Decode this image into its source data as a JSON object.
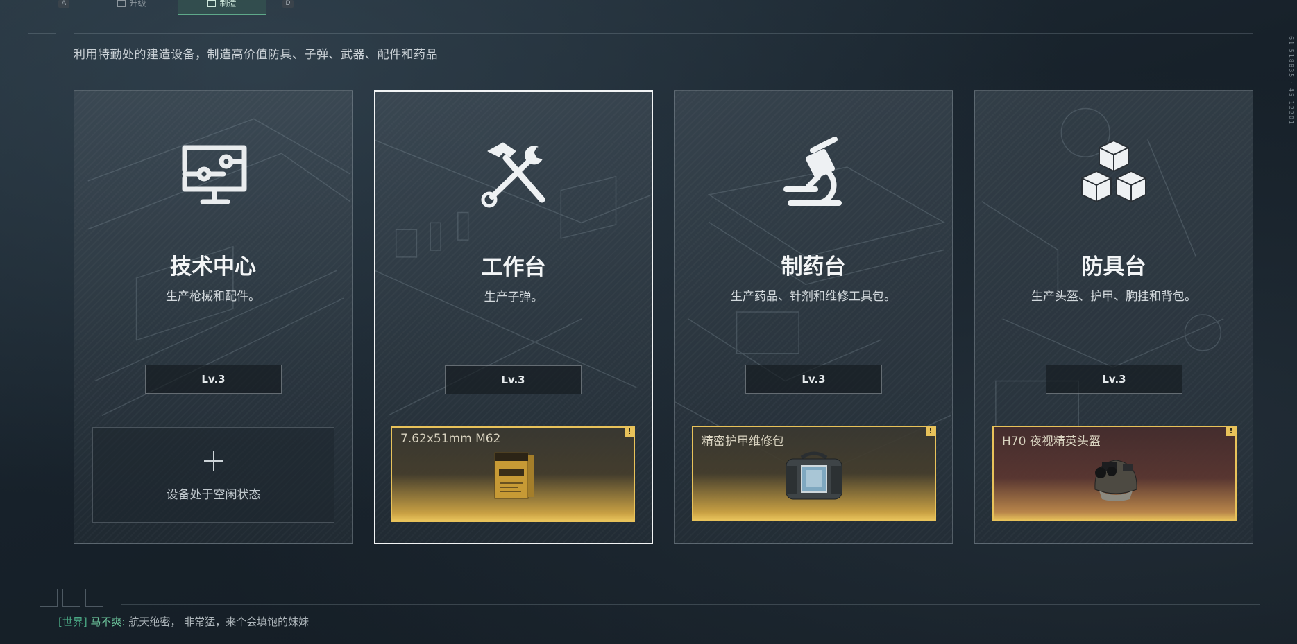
{
  "tabs": {
    "left_key": "A",
    "right_key": "D",
    "items": [
      {
        "label": "升级"
      },
      {
        "label": "制造"
      }
    ]
  },
  "subtitle": "利用特勤处的建造设备，制造高价值防具、子弹、武器、配件和药品",
  "cards": [
    {
      "title": "技术中心",
      "desc": "生产枪械和配件。",
      "level": "Lv.3",
      "icon": "monitor-circuit-icon",
      "idle_text": "设备处于空闲状态"
    },
    {
      "title": "工作台",
      "desc": "生产子弹。",
      "level": "Lv.3",
      "icon": "hammer-wrench-icon",
      "product": "7.62x51mm M62"
    },
    {
      "title": "制药台",
      "desc": "生产药品、针剂和维修工具包。",
      "level": "Lv.3",
      "icon": "microscope-icon",
      "product": "精密护甲维修包"
    },
    {
      "title": "防具台",
      "desc": "生产头盔、护甲、胸挂和背包。",
      "level": "Lv.3",
      "icon": "boxes-icon",
      "product": "H70 夜视精英头盔"
    }
  ],
  "product_alert": "!",
  "chat": {
    "channel": "[世界]",
    "user": "马不爽:",
    "message": "航天绝密， 非常猛，来个会填饱的妹妹"
  },
  "colors": {
    "accent_gold": "#e8c25a",
    "tab_active": "#5fa98a",
    "chat_channel": "#4aa884"
  }
}
